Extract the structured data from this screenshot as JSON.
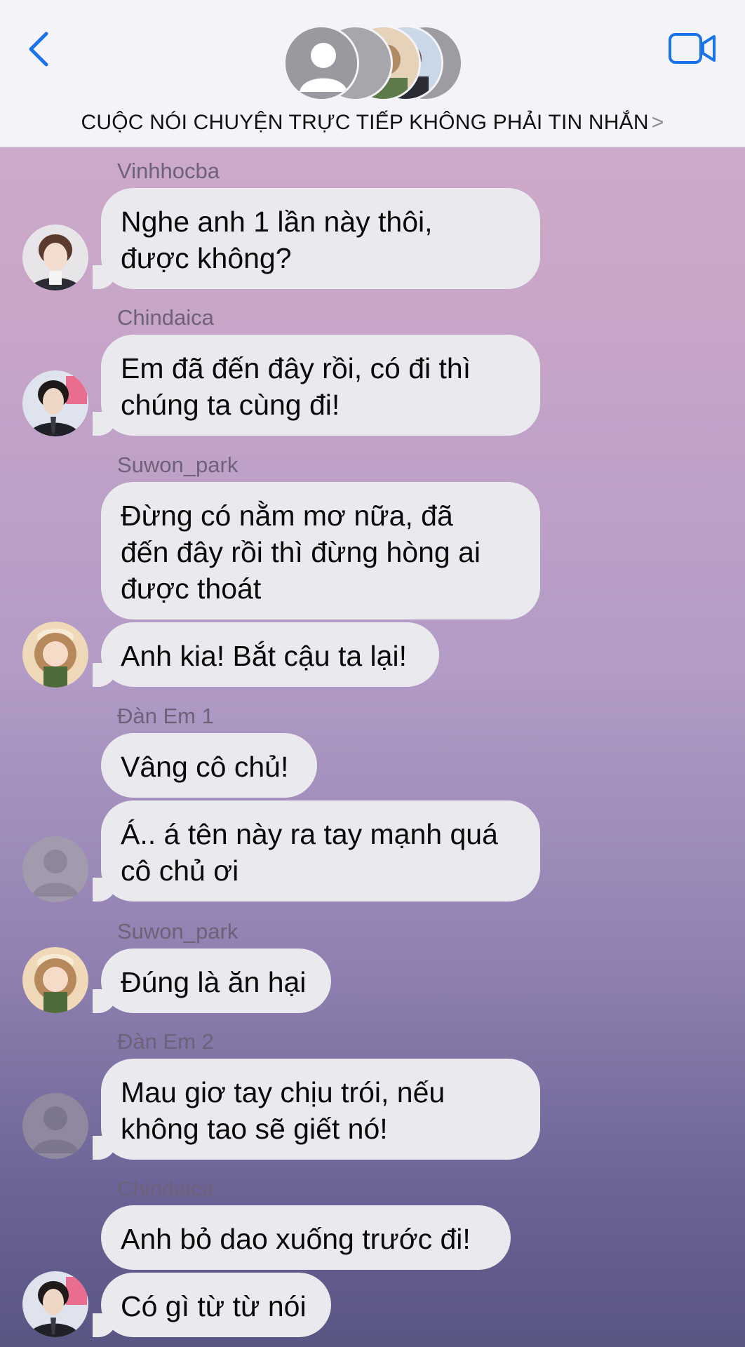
{
  "header": {
    "title": "CUỘC NÓI CHUYỆN TRỰC TIẾP KHÔNG PHẢI TIN NHẮN",
    "chevron": ">",
    "back_icon": "chevron-left-icon",
    "video_icon": "video-camera-icon",
    "accent_color": "#1a73e8"
  },
  "messages": [
    {
      "sender": "Vinhhocba",
      "text": "Nghe anh 1 lần này thôi,\nđược không?"
    },
    {
      "sender": "Chindaica",
      "text": "Em đã đến đây rồi, có đi thì\nchúng ta cùng đi!"
    },
    {
      "sender": "Suwon_park",
      "text": "Đừng có nằm mơ nữa, đã\nđến đây rồi thì đừng hòng ai\nđược thoát"
    },
    {
      "sender": "",
      "text": "Anh kia! Bắt cậu ta lại!"
    },
    {
      "sender": "Đàn Em 1",
      "text": "Vâng cô chủ!"
    },
    {
      "sender": "",
      "text": "Á.. á tên này ra tay mạnh quá\ncô chủ ơi"
    },
    {
      "sender": "Suwon_park",
      "text": "Đúng là ăn hại"
    },
    {
      "sender": "Đàn Em 2",
      "text": "Mau giơ tay chịu trói, nếu\nkhông tao sẽ giết nó!"
    },
    {
      "sender": "Chindaica",
      "text": "Anh bỏ dao xuống trước đi!"
    },
    {
      "sender": "",
      "text": "Có gì từ từ nói"
    }
  ],
  "colors": {
    "bubble": "#e9e9ee",
    "sender_text": "#6e6278"
  }
}
